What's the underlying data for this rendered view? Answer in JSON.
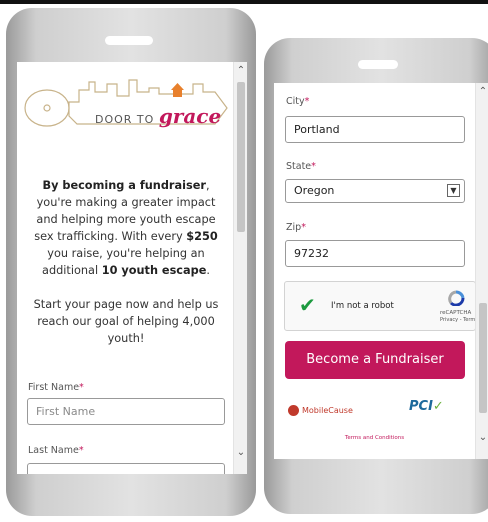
{
  "left_screen": {
    "logo": {
      "prefix": "DOOR TO ",
      "highlight": "grace"
    },
    "intro": {
      "lead": "By becoming a fundraiser",
      "text1": ", you're making a greater impact and helping more youth escape sex trafficking. With every ",
      "amount": "$250",
      "text2": " you raise, you're helping an additional ",
      "youth": "10 youth escape",
      "text3": "."
    },
    "goal_text": "Start your page now and help us reach our goal of helping 4,000 youth!",
    "fields": {
      "first_name": {
        "label": "First Name",
        "placeholder": "First Name"
      },
      "last_name": {
        "label": "Last Name"
      }
    }
  },
  "right_screen": {
    "fields": {
      "city": {
        "label": "City",
        "value": "Portland"
      },
      "state": {
        "label": "State",
        "value": "Oregon"
      },
      "zip": {
        "label": "Zip",
        "value": "97232"
      }
    },
    "recaptcha": {
      "label": "I'm not a robot",
      "brand": "reCAPTCHA",
      "links": "Privacy - Terms"
    },
    "cta_button": "Become a Fundraiser",
    "footer": {
      "mobilecause": "MobileCause",
      "pci": "PCI",
      "terms": "Terms and Conditions"
    }
  },
  "required_mark": "*",
  "colors": {
    "accent": "#c2185b",
    "check": "#1c9a3f"
  },
  "icons": [
    "house-icon",
    "chevron-up-icon",
    "chevron-down-icon",
    "dropdown-arrow-icon",
    "checkmark-icon",
    "recaptcha-icon",
    "mobilecause-icon",
    "pci-logo"
  ]
}
